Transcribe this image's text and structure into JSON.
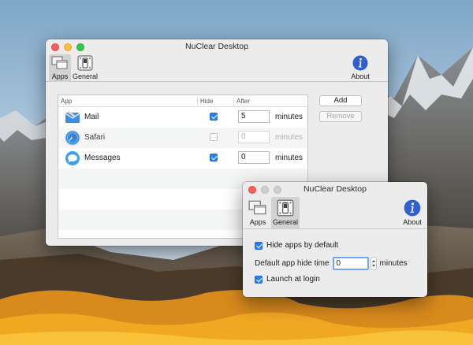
{
  "main_window": {
    "title": "NuClear Desktop",
    "toolbar": {
      "apps_label": "Apps",
      "general_label": "General",
      "about_label": "About"
    },
    "table": {
      "headers": {
        "app": "App",
        "hide": "Hide",
        "after": "After"
      },
      "rows": [
        {
          "name": "Mail",
          "icon": "mail-icon",
          "hide": true,
          "after": "5",
          "unit": "minutes"
        },
        {
          "name": "Safari",
          "icon": "safari-icon",
          "hide": false,
          "after": "0",
          "unit": "minutes"
        },
        {
          "name": "Messages",
          "icon": "messages-icon",
          "hide": true,
          "after": "0",
          "unit": "minutes"
        }
      ]
    },
    "buttons": {
      "add": "Add",
      "remove": "Remove"
    }
  },
  "general_window": {
    "title": "NuClear Desktop",
    "toolbar": {
      "apps_label": "Apps",
      "general_label": "General",
      "about_label": "About"
    },
    "hide_by_default_label": "Hide apps by default",
    "hide_by_default": true,
    "hide_time_label": "Default app hide time",
    "hide_time_value": "0",
    "hide_time_unit": "minutes",
    "launch_at_login_label": "Launch at login",
    "launch_at_login": true
  },
  "colors": {
    "accent": "#2a7ef3",
    "close": "#fc605b",
    "minimize": "#fdbc40",
    "maximize": "#34c84a",
    "info_icon": "#2f5fd1"
  }
}
